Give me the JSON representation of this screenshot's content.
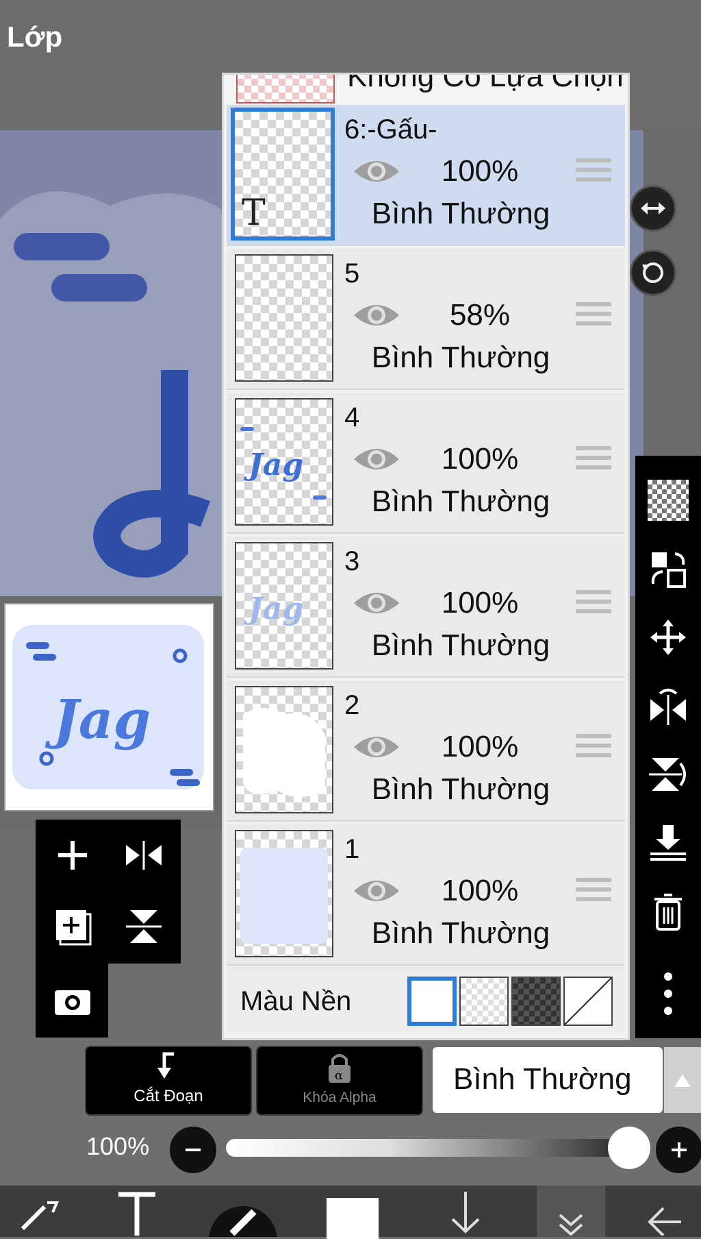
{
  "header": {
    "title": "Lớp"
  },
  "layer_panel": {
    "top_item_label": "Không Có Lựa Chọn",
    "layers": [
      {
        "name": "6:-Gấu-",
        "opacity": "100%",
        "blend": "Bình Thường",
        "selected": true,
        "text_layer_glyph": "T"
      },
      {
        "name": "5",
        "opacity": "58%",
        "blend": "Bình Thường",
        "selected": false
      },
      {
        "name": "4",
        "opacity": "100%",
        "blend": "Bình Thường",
        "selected": false
      },
      {
        "name": "3",
        "opacity": "100%",
        "blend": "Bình Thường",
        "selected": false
      },
      {
        "name": "2",
        "opacity": "100%",
        "blend": "Bình Thường",
        "selected": false
      },
      {
        "name": "1",
        "opacity": "100%",
        "blend": "Bình Thường",
        "selected": false
      }
    ],
    "background": {
      "label": "Màu Nền",
      "options": [
        "white",
        "transparent-light",
        "transparent-dark",
        "none"
      ],
      "selected": "white"
    }
  },
  "actions": {
    "clip_label": "Cắt Đoạn",
    "alpha_lock_label": "Khóa Alpha",
    "blend_mode": "Bình Thường"
  },
  "opacity_slider": {
    "label": "100%",
    "value": 1.0
  },
  "icons": {
    "left_tools": [
      "plus-icon",
      "flip-horizontal-icon",
      "add-layer-icon",
      "flip-vertical-icon",
      "camera-icon"
    ],
    "right_tools": [
      "transparency-icon",
      "copy-transform-icon",
      "move-icon",
      "flip-h-icon",
      "flip-v-icon",
      "merge-down-icon",
      "trash-icon",
      "more-icon"
    ],
    "bottom_tools": [
      "transform-icon",
      "text-icon",
      "brush-icon",
      "color-swatch-icon",
      "arrow-down-icon",
      "collapse-icon",
      "back-icon"
    ]
  },
  "colors": {
    "accent": "#2f7bd8",
    "selected_row": "#cfdcf0",
    "artwork_blue": "#3f5bb5",
    "artwork_light": "#dde5fb"
  }
}
